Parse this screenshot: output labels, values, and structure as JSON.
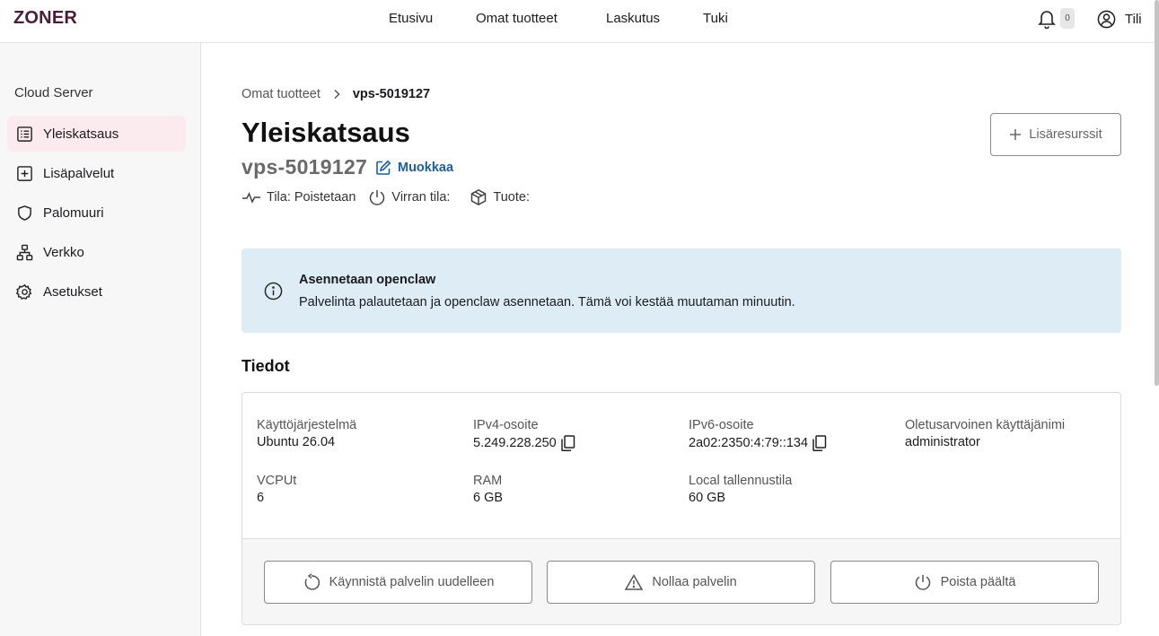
{
  "brand": {
    "logo": "ZONER",
    "logo_color": "#4a1d3c"
  },
  "nav": {
    "items": [
      "Etusivu",
      "Omat tuotteet",
      "Laskutus",
      "Tuki"
    ]
  },
  "header": {
    "notifications_count": "0",
    "account_label": "Tili"
  },
  "sidebar": {
    "title": "Cloud Server",
    "items": [
      {
        "label": "Yleiskatsaus",
        "icon": "list-icon",
        "active": true
      },
      {
        "label": "Lisäpalvelut",
        "icon": "plus-square-icon"
      },
      {
        "label": "Palomuuri",
        "icon": "shield-icon"
      },
      {
        "label": "Verkko",
        "icon": "network-icon"
      },
      {
        "label": "Asetukset",
        "icon": "gear-icon"
      }
    ]
  },
  "breadcrumb": {
    "parent": "Omat tuotteet",
    "current": "vps-5019127"
  },
  "page": {
    "title": "Yleiskatsaus",
    "server_name": "vps-5019127",
    "edit_label": "Muokkaa",
    "status": {
      "state": "Tila: Poistetaan",
      "power": "Virran tila:",
      "product": "Tuote:"
    },
    "add_resources": "Lisäresurssit"
  },
  "alert": {
    "title": "Asennetaan openclaw",
    "text": "Palvelinta palautetaan ja openclaw asennetaan. Tämä voi kestää muutaman minuutin.",
    "bg_color": "#ddecf5"
  },
  "details": {
    "title": "Tiedot",
    "os": {
      "label": "Käyttöjärjestelmä",
      "value": "Ubuntu 26.04"
    },
    "ipv4": {
      "label": "IPv4-osoite",
      "value": "5.249.228.250"
    },
    "ipv6": {
      "label": "IPv6-osoite",
      "value": "2a02:2350:4:79::134"
    },
    "username": {
      "label": "Oletusarvoinen käyttäjänimi",
      "value": "administrator"
    },
    "vcpu": {
      "label": "VCPUt",
      "value": "6"
    },
    "ram": {
      "label": "RAM",
      "value": "6 GB"
    },
    "storage": {
      "label": "Local tallennustila",
      "value": "60 GB"
    }
  },
  "actions": {
    "restart": "Käynnistä palvelin uudelleen",
    "reset": "Nollaa palvelin",
    "power_off": "Poista päältä"
  }
}
